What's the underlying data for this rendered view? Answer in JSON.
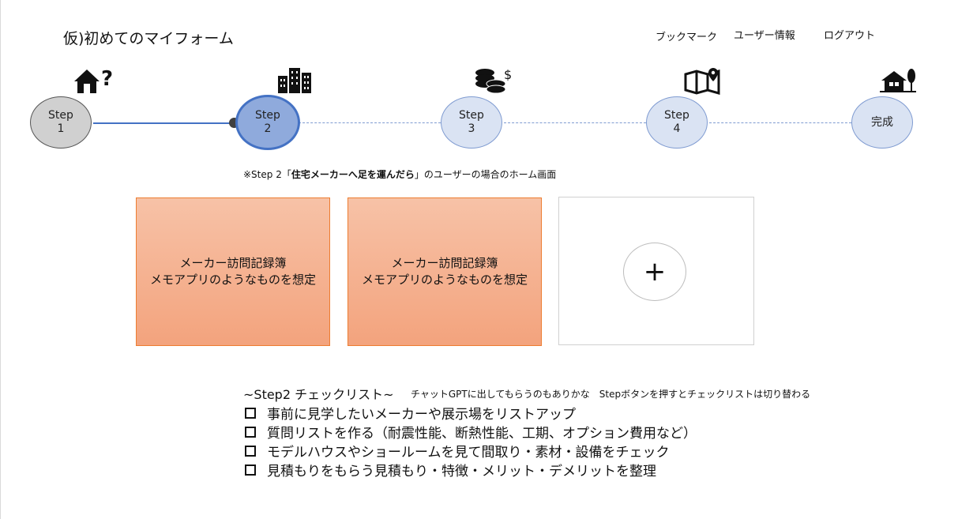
{
  "app": {
    "title": "仮)初めてのマイフォーム"
  },
  "nav": {
    "bookmark": "ブックマーク",
    "user_info": "ユーザー情報",
    "logout": "ログアウト"
  },
  "steps": [
    {
      "label": "Step",
      "number": "1",
      "state": "done",
      "icon": "house-question-icon"
    },
    {
      "label": "Step",
      "number": "2",
      "state": "current",
      "icon": "buildings-icon"
    },
    {
      "label": "Step",
      "number": "3",
      "state": "upcoming",
      "icon": "coins-dollar-icon"
    },
    {
      "label": "Step",
      "number": "4",
      "state": "upcoming",
      "icon": "map-pin-icon"
    },
    {
      "label": "完成",
      "number": "",
      "state": "upcoming",
      "icon": "house-tree-icon"
    }
  ],
  "note": {
    "prefix": "※Step 2「",
    "highlight": "住宅メーカーへ足を運んだら",
    "suffix": "」のユーザーの場合のホーム画面"
  },
  "cards": [
    {
      "line1": "メーカー訪問記録簿",
      "line2": "メモアプリのようなものを想定"
    },
    {
      "line1": "メーカー訪問記録簿",
      "line2": "メモアプリのようなものを想定"
    }
  ],
  "add_card": {
    "symbol": "+"
  },
  "checklist": {
    "title": "~Step2 チェックリスト~",
    "hint": "チャットGPTに出してもらうのもありかな　Stepボタンを押すとチェックリストは切り替わる",
    "items": [
      "事前に見学したいメーカーや展示場をリストアップ",
      "質問リストを作る（耐震性能、断熱性能、工期、オプション費用など）",
      "モデルハウスやショールームを見て間取り・素材・設備をチェック",
      "見積もりをもらう見積もり・特徴・メリット・デメリットを整理"
    ]
  },
  "colors": {
    "accent": "#4472c4",
    "step_fill": "#dae3f3",
    "done_fill": "#d0d0d0",
    "card_fill": "#f4b183",
    "card_border": "#ed7d31"
  }
}
